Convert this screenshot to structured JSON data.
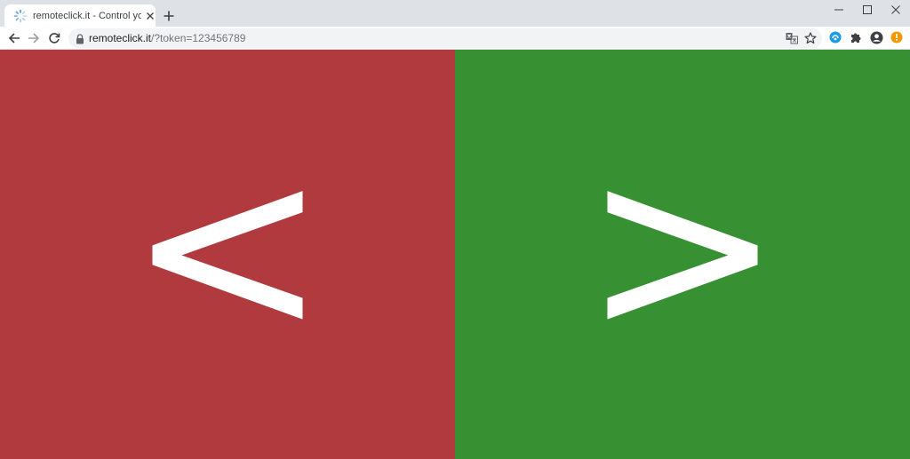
{
  "browser": {
    "tab": {
      "title": "remoteclick.it - Control your slide",
      "favicon": "loading-spinner-icon"
    },
    "address_bar": {
      "host": "remoteclick.it",
      "path": "/?token=123456789"
    },
    "icons": {
      "back": "arrow-left-icon",
      "forward": "arrow-right-icon",
      "reload": "reload-icon",
      "translate": "translate-icon",
      "bookmark": "star-icon",
      "extension": "extension-icon",
      "extensions_menu": "puzzle-icon",
      "profile": "profile-icon",
      "alert": "update-alert-icon"
    }
  },
  "page": {
    "left": {
      "label": "<",
      "color": "#b03a3e"
    },
    "right": {
      "label": ">",
      "color": "#379132"
    }
  }
}
